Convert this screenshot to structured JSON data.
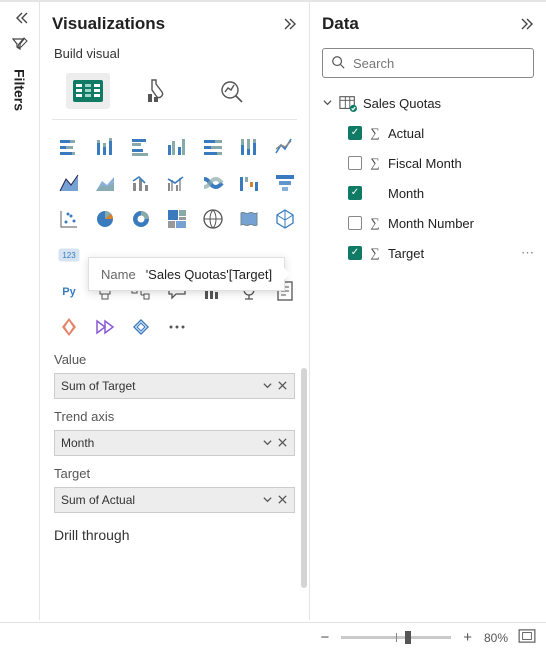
{
  "filters": {
    "label": "Filters"
  },
  "viz": {
    "title": "Visualizations",
    "subtitle": "Build visual",
    "fields": {
      "value": {
        "label": "Value",
        "well": "Sum of Target"
      },
      "trend": {
        "label": "Trend axis",
        "well": "Month"
      },
      "target": {
        "label": "Target",
        "well": "Sum of Actual"
      }
    },
    "drill": "Drill through",
    "tooltip": {
      "label": "Name",
      "value": "'Sales Quotas'[Target]"
    }
  },
  "data": {
    "title": "Data",
    "search_placeholder": "Search",
    "table": "Sales Quotas",
    "fields": [
      {
        "name": "Actual",
        "checked": true,
        "sigma": true
      },
      {
        "name": "Fiscal Month",
        "checked": false,
        "sigma": true
      },
      {
        "name": "Month",
        "checked": true,
        "sigma": false
      },
      {
        "name": "Month Number",
        "checked": false,
        "sigma": true
      },
      {
        "name": "Target",
        "checked": true,
        "sigma": true,
        "more": true
      }
    ]
  },
  "status": {
    "zoom": "80%"
  },
  "colors": {
    "accent": "#0f7b64",
    "blue": "#3a7bbf",
    "orange": "#d9822b"
  }
}
